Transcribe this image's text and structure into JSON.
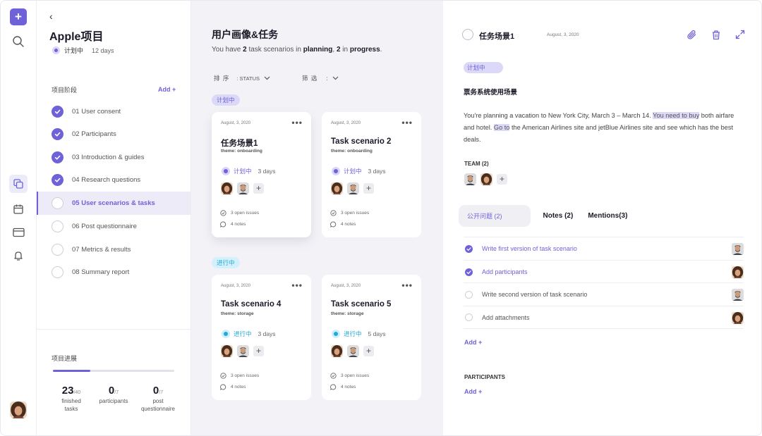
{
  "rail": {
    "add_label": "+",
    "icons": [
      "search-icon",
      "copy-icon",
      "calendar-icon",
      "card-icon",
      "bell-icon"
    ]
  },
  "sidebar": {
    "back_label": "‹",
    "project_title": "Apple项目",
    "status_label": "计划中",
    "status_days": "12 days",
    "stages_title": "项目阶段",
    "add_label": "Add +",
    "steps": [
      {
        "label": "01 User consent",
        "done": true
      },
      {
        "label": "02  Participants",
        "done": true
      },
      {
        "label": "03  Introduction & guides",
        "done": true
      },
      {
        "label": "04  Research questions",
        "done": true
      },
      {
        "label": "05  User scenarios & tasks",
        "done": false,
        "active": true
      },
      {
        "label": "06  Post questionnaire",
        "done": false
      },
      {
        "label": "07  Metrics & results",
        "done": false
      },
      {
        "label": "08  Summary report",
        "done": false
      }
    ],
    "progress_title": "项目进展",
    "progress_fraction": 0.31,
    "stats": [
      {
        "num": "23",
        "den": "/40",
        "label1": "finished",
        "label2": "tasks"
      },
      {
        "num": "0",
        "den": "/7",
        "label1": "participants",
        "label2": ""
      },
      {
        "num": "0",
        "den": "/7",
        "label1": "post",
        "label2": "questionnaire"
      }
    ]
  },
  "board": {
    "title": "用户画像&任务",
    "subtitle_pre": "You have ",
    "subtitle_n1": "2",
    "subtitle_mid1": " task scenarios in ",
    "subtitle_state1": "planning",
    "subtitle_mid2": ", ",
    "subtitle_n2": "2",
    "subtitle_mid3": " in ",
    "subtitle_state2": "progress",
    "subtitle_end": ".",
    "sort_label": "排 序",
    "sort_value": ": STATUS",
    "filter_label": "筛 选",
    "filter_value": ":",
    "group_planning": "计划中",
    "group_progress": "进行中",
    "cards": [
      {
        "date": "August, 3, 2020",
        "title": "任务场景1",
        "theme": "theme: onboarding",
        "status": "计划中",
        "days": "3 days",
        "issues": "3 open issues",
        "notes": "4 notes"
      },
      {
        "date": "August, 3, 2020",
        "title": "Task scenario 2",
        "theme": "theme: onboarding",
        "status": "计划中",
        "days": "3 days",
        "issues": "3 open issues",
        "notes": "4 notes"
      },
      {
        "date": "August, 3, 2020",
        "title": "Task scenario 4",
        "theme": "theme: storage",
        "status": "进行中",
        "days": "3 days",
        "issues": "3 open issues",
        "notes": "4 notes"
      },
      {
        "date": "August, 3, 2020",
        "title": "Task scenario 5",
        "theme": "theme: storage",
        "status": "进行中",
        "days": "5 days",
        "issues": "3 open issues",
        "notes": "4 notes"
      }
    ],
    "dots": "•••"
  },
  "detail": {
    "title": "任务场景1",
    "date": "August, 3, 2020",
    "tag": "计划中",
    "heading": "票务系统使用场景",
    "desc_1": "You're planning a vacation to New York City, March 3 – March 14. ",
    "desc_hl1": "You need to buy",
    "desc_2": " both airfare and hotel. ",
    "desc_hl2": "Go to",
    "desc_3": " the American Airlines site and jetBlue Airlines site and see which has the best deals.",
    "team_label": "TEAM (2)",
    "tabs": [
      "公开问题  (2)",
      "Notes (2)",
      "Mentions(3)"
    ],
    "tasks": [
      {
        "text": "Write first version of task scenario",
        "done": true
      },
      {
        "text": "Add participants",
        "done": true
      },
      {
        "text": "Write second version of task scenario",
        "done": false
      },
      {
        "text": "Add attachments",
        "done": false
      }
    ],
    "add_task": "Add +",
    "participants_label": "PARTICIPANTS",
    "add_participant": "Add +"
  },
  "colors": {
    "accent": "#6f62d8",
    "accent_light": "#dcd8f7",
    "progress_blue": "#23a9d8",
    "board_bg": "#f3f3f7"
  }
}
